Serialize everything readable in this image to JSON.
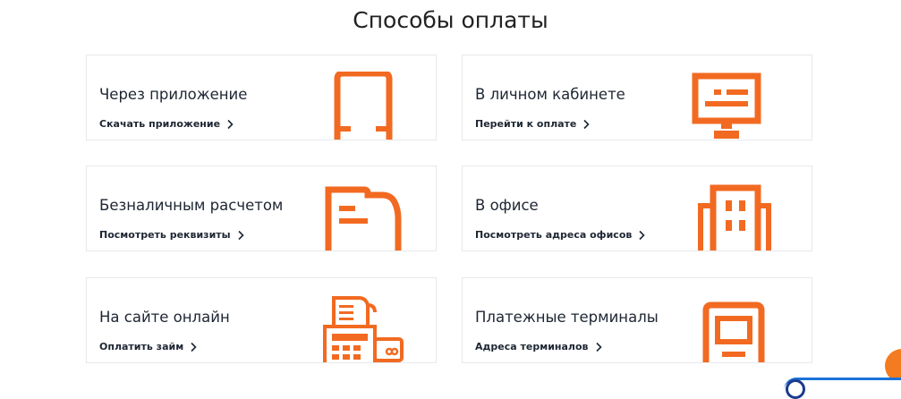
{
  "section_title": "Способы оплаты",
  "accent_color": "#f26a21",
  "cards": [
    {
      "title": "Через приложение",
      "link": "Скачать приложение",
      "icon": "phone-icon"
    },
    {
      "title": "В личном кабинете",
      "link": "Перейти к оплате",
      "icon": "monitor-icon"
    },
    {
      "title": "Безналичным расчетом",
      "link": "Посмотреть реквизиты",
      "icon": "document-icon"
    },
    {
      "title": "В офисе",
      "link": "Посмотреть адреса офисов",
      "icon": "office-building-icon"
    },
    {
      "title": "На сайте онлайн",
      "link": "Оплатить займ",
      "icon": "payment-terminal-card-icon"
    },
    {
      "title": "Платежные терминалы",
      "link": "Адреса терминалов",
      "icon": "kiosk-terminal-icon"
    }
  ]
}
